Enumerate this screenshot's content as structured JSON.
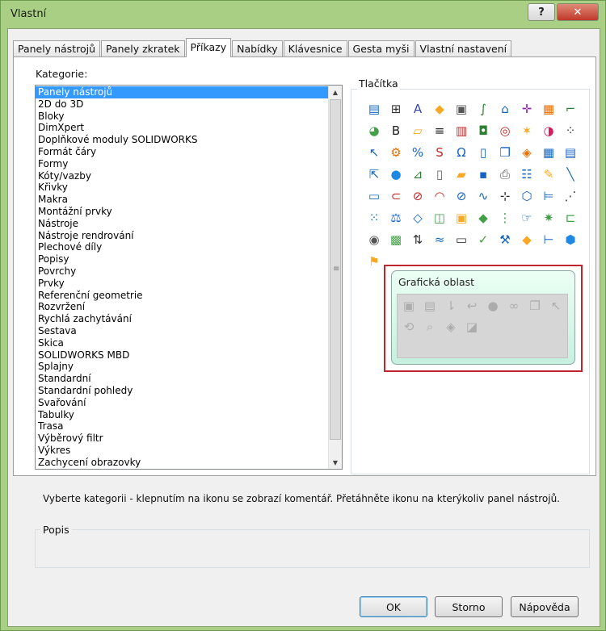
{
  "window": {
    "title": "Vlastní",
    "help_glyph": "?",
    "close_glyph": "✕"
  },
  "tabs": [
    {
      "label": "Panely nástrojů",
      "active": false
    },
    {
      "label": "Panely zkratek",
      "active": false
    },
    {
      "label": "Příkazy",
      "active": true
    },
    {
      "label": "Nabídky",
      "active": false
    },
    {
      "label": "Klávesnice",
      "active": false
    },
    {
      "label": "Gesta myši",
      "active": false
    },
    {
      "label": "Vlastní  nastavení",
      "active": false
    }
  ],
  "categories": {
    "label": "Kategorie:",
    "selected_index": 0,
    "items": [
      "Panely nástrojů",
      "2D do 3D",
      "Bloky",
      "DimXpert",
      "Doplňkové moduly SOLIDWORKS",
      "Formát čáry",
      "Formy",
      "Kóty/vazby",
      "Křivky",
      "Makra",
      "Montážní prvky",
      "Nástroje",
      "Nástroje rendrování",
      "Plechové díly",
      "Popisy",
      "Povrchy",
      "Prvky",
      "Referenční geometrie",
      "Rozvržení",
      "Rychlá zachytávání",
      "Sestava",
      "Skica",
      "SOLIDWORKS MBD",
      "Splajny",
      "Standardní",
      "Standardní pohledy",
      "Svařování",
      "Tabulky",
      "Trasa",
      "Výběrový filtr",
      "Výkres",
      "Zachycení obrazovky"
    ],
    "scroll_up": "▲",
    "scroll_down": "▼",
    "grip": "≡"
  },
  "buttons_group": {
    "label": "Tlačítka",
    "icons": [
      {
        "name": "layers-icon",
        "glyph": "▤",
        "color": "#1565c0"
      },
      {
        "name": "grid-tool-icon",
        "glyph": "⊞",
        "color": "#333"
      },
      {
        "name": "text-icon",
        "glyph": "A",
        "color": "#3949ab"
      },
      {
        "name": "part-cube-icon",
        "glyph": "◆",
        "color": "#f9a825"
      },
      {
        "name": "note-icon",
        "glyph": "▣",
        "color": "#555"
      },
      {
        "name": "curve-icon",
        "glyph": "∫",
        "color": "#2e7d32"
      },
      {
        "name": "tree-icon",
        "glyph": "⌂",
        "color": "#1565c0"
      },
      {
        "name": "crosshair-icon",
        "glyph": "✛",
        "color": "#8e24aa"
      },
      {
        "name": "table-icon",
        "glyph": "▦",
        "color": "#ef6c00"
      },
      {
        "name": "stairs-icon",
        "glyph": "⌐",
        "color": "#2e7d32"
      },
      {
        "name": "globe-folder-icon",
        "glyph": "◕",
        "color": "#43a047"
      },
      {
        "name": "bold-text-icon",
        "glyph": "B",
        "color": "#222"
      },
      {
        "name": "plane-icon",
        "glyph": "▱",
        "color": "#f9a825"
      },
      {
        "name": "lines-icon",
        "glyph": "≡",
        "color": "#222"
      },
      {
        "name": "chart-icon",
        "glyph": "▥",
        "color": "#c62828"
      },
      {
        "name": "box-icon",
        "glyph": "◘",
        "color": "#2e7d32"
      },
      {
        "name": "target-icon",
        "glyph": "◎",
        "color": "#c62828"
      },
      {
        "name": "magic-icon",
        "glyph": "✶",
        "color": "#f9a825"
      },
      {
        "name": "color-wheel-icon",
        "glyph": "◑",
        "color": "#d81b60"
      },
      {
        "name": "grid-dots-icon",
        "glyph": "⁘",
        "color": "#333"
      },
      {
        "name": "pointer-icon",
        "glyph": "↖",
        "color": "#1565c0"
      },
      {
        "name": "gear-box-icon",
        "glyph": "⚙",
        "color": "#ef6c00"
      },
      {
        "name": "percent-icon",
        "glyph": "%",
        "color": "#1565c0"
      },
      {
        "name": "sw-logo-icon",
        "glyph": "S",
        "color": "#c62828"
      },
      {
        "name": "arch-icon",
        "glyph": "Ω",
        "color": "#1565c0"
      },
      {
        "name": "document-icon",
        "glyph": "▯",
        "color": "#1565c0"
      },
      {
        "name": "stack-icon",
        "glyph": "❐",
        "color": "#1565c0"
      },
      {
        "name": "ruler-icon",
        "glyph": "◈",
        "color": "#ef6c00"
      },
      {
        "name": "spreadsheet-icon",
        "glyph": "▦",
        "color": "#1565c0"
      },
      {
        "name": "print-preview-icon",
        "glyph": "▤",
        "color": "#1565c0"
      },
      {
        "name": "export-icon",
        "glyph": "⇱",
        "color": "#1565c0"
      },
      {
        "name": "globe-icon",
        "glyph": "●",
        "color": "#1e88e5"
      },
      {
        "name": "chart-axis-icon",
        "glyph": "⊿",
        "color": "#2e7d32"
      },
      {
        "name": "new-document-icon",
        "glyph": "▯",
        "color": "#666"
      },
      {
        "name": "open-folder-icon",
        "glyph": "▰",
        "color": "#f9a825"
      },
      {
        "name": "save-icon",
        "glyph": "▪",
        "color": "#1565c0"
      },
      {
        "name": "printer-icon",
        "glyph": "⎙",
        "color": "#555"
      },
      {
        "name": "properties-icon",
        "glyph": "☷",
        "color": "#1565c0"
      },
      {
        "name": "edit-icon",
        "glyph": "✎",
        "color": "#f9a825"
      },
      {
        "name": "line-icon",
        "glyph": "╲",
        "color": "#1565c0"
      },
      {
        "name": "rectangle-icon",
        "glyph": "▭",
        "color": "#1565c0"
      },
      {
        "name": "slot-icon",
        "glyph": "⊂",
        "color": "#c62828"
      },
      {
        "name": "dimension-circle-icon",
        "glyph": "⊘",
        "color": "#c62828"
      },
      {
        "name": "arc-icon",
        "glyph": "◠",
        "color": "#c62828"
      },
      {
        "name": "ellipse-icon",
        "glyph": "⊘",
        "color": "#1565c0"
      },
      {
        "name": "spline-icon",
        "glyph": "∿",
        "color": "#1565c0"
      },
      {
        "name": "centerpoint-icon",
        "glyph": "⊹",
        "color": "#222"
      },
      {
        "name": "3d-box-icon",
        "glyph": "⬡",
        "color": "#1565c0"
      },
      {
        "name": "mirror-icon",
        "glyph": "⊨",
        "color": "#1565c0"
      },
      {
        "name": "convert-icon",
        "glyph": "⋰",
        "color": "#333"
      },
      {
        "name": "pattern-icon",
        "glyph": "⁙",
        "color": "#1565c0"
      },
      {
        "name": "measure-icon",
        "glyph": "⚖",
        "color": "#1565c0"
      },
      {
        "name": "dimension-icon",
        "glyph": "◇",
        "color": "#1565c0"
      },
      {
        "name": "component-icon",
        "glyph": "◫",
        "color": "#43a047"
      },
      {
        "name": "assembly-icon",
        "glyph": "▣",
        "color": "#f9a825"
      },
      {
        "name": "mate-icon",
        "glyph": "◆",
        "color": "#43a047"
      },
      {
        "name": "chain-icon",
        "glyph": "⋮",
        "color": "#43a047"
      },
      {
        "name": "hand-icon",
        "glyph": "☞",
        "color": "#1565c0"
      },
      {
        "name": "explode-icon",
        "glyph": "✷",
        "color": "#43a047"
      },
      {
        "name": "bracket-icon",
        "glyph": "⊏",
        "color": "#43a047"
      },
      {
        "name": "camera-icon",
        "glyph": "◉",
        "color": "#555"
      },
      {
        "name": "view-palette-icon",
        "glyph": "▩",
        "color": "#43a047"
      },
      {
        "name": "transfer-icon",
        "glyph": "⇅",
        "color": "#333"
      },
      {
        "name": "zigzag-icon",
        "glyph": "≈",
        "color": "#1565c0"
      },
      {
        "name": "monitor-icon",
        "glyph": "▭",
        "color": "#333"
      },
      {
        "name": "check-delete-icon",
        "glyph": "✓",
        "color": "#43a047"
      },
      {
        "name": "tools-icon",
        "glyph": "⚒",
        "color": "#1565c0"
      },
      {
        "name": "puzzle-icon",
        "glyph": "◆",
        "color": "#f9a825"
      },
      {
        "name": "tree-view-icon",
        "glyph": "⊢",
        "color": "#1565c0"
      },
      {
        "name": "blue-cube-icon",
        "glyph": "⬢",
        "color": "#1e88e5"
      },
      {
        "name": "custom-tool-icon",
        "glyph": "⚑",
        "color": "#f9a825"
      }
    ]
  },
  "graphics_area": {
    "title": "Grafická oblast",
    "icons": [
      {
        "name": "view-orient-icon",
        "glyph": "▣"
      },
      {
        "name": "display-style-icon",
        "glyph": "▤"
      },
      {
        "name": "sort-icon",
        "glyph": "⇂"
      },
      {
        "name": "undo-icon",
        "glyph": "↩"
      },
      {
        "name": "sphere-icon",
        "glyph": "●"
      },
      {
        "name": "link-icon",
        "glyph": "∞"
      },
      {
        "name": "copy-icon",
        "glyph": "❐"
      },
      {
        "name": "select-icon",
        "glyph": "↖"
      },
      {
        "name": "rotate-icon",
        "glyph": "⟲"
      },
      {
        "name": "zoom-icon",
        "glyph": "⌕"
      },
      {
        "name": "hide-icon",
        "glyph": "◈"
      },
      {
        "name": "section-icon",
        "glyph": "◪"
      }
    ]
  },
  "hint": "Vyberte kategorii - klepnutím na ikonu se zobrazí komentář. Přetáhněte ikonu na kterýkoliv panel nástrojů.",
  "description": {
    "label": "Popis",
    "text": ""
  },
  "footer": {
    "ok": "OK",
    "cancel": "Storno",
    "help": "Nápověda"
  }
}
